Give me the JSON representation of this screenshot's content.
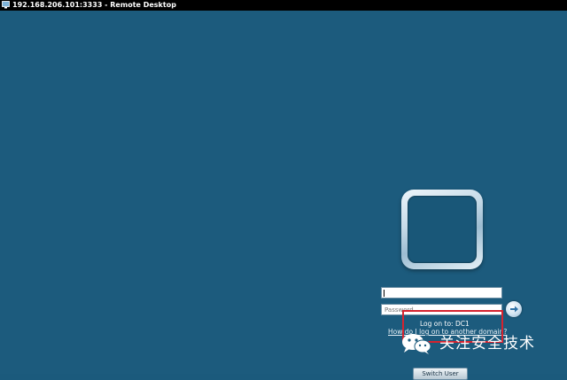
{
  "window": {
    "title": "192.168.206.101:3333 - Remote Desktop"
  },
  "logon": {
    "username_value": "",
    "password_placeholder": "Password",
    "logon_to": "Log on to: DC1",
    "other_domain_link": "How do I log on to another domain?",
    "cancel_button": "Switch User"
  },
  "watermark": {
    "text": "关注安全技术",
    "icon": "wechat-icon"
  },
  "colors": {
    "desktop_background": "#1c5b7d",
    "titlebar": "#000000",
    "highlight_box": "#d5232f"
  }
}
